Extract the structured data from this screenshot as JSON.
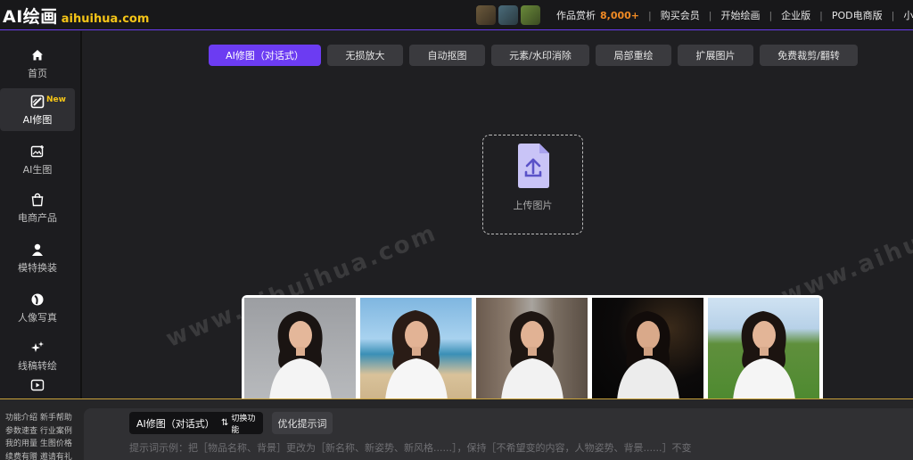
{
  "header": {
    "logo_main": "AI绘画",
    "logo_domain": "aihuihua.com",
    "nav": {
      "works_label": "作品赏析",
      "works_count": "8,000+",
      "buy_member": "购买会员",
      "start_drawing": "开始绘画",
      "enterprise": "企业版",
      "pod": "POD电商版",
      "mini_program": "小程序"
    },
    "separator": "|"
  },
  "sidebar": {
    "items": [
      {
        "label": "首页",
        "icon": "home-icon"
      },
      {
        "label": "AI修图",
        "icon": "edit-image-icon",
        "badge": "New"
      },
      {
        "label": "AI生图",
        "icon": "image-plus-icon"
      },
      {
        "label": "电商产品",
        "icon": "shopping-bag-icon"
      },
      {
        "label": "模特换装",
        "icon": "person-icon"
      },
      {
        "label": "人像写真",
        "icon": "portrait-icon"
      },
      {
        "label": "线稿转绘",
        "icon": "sparkle-icon"
      },
      {
        "label": "",
        "icon": "video-icon"
      }
    ]
  },
  "tabs": [
    {
      "label": "AI修图（对话式）",
      "active": true
    },
    {
      "label": "无损放大",
      "active": false
    },
    {
      "label": "自动抠图",
      "active": false
    },
    {
      "label": "元素/水印消除",
      "active": false
    },
    {
      "label": "局部重绘",
      "active": false
    },
    {
      "label": "扩展图片",
      "active": false
    },
    {
      "label": "免费裁剪/翻转",
      "active": false
    }
  ],
  "upload": {
    "label": "上传图片",
    "icon": "upload-file-icon"
  },
  "watermark": "www.aihuihua.com",
  "samples": [
    {
      "background": "studio"
    },
    {
      "background": "beach"
    },
    {
      "background": "street"
    },
    {
      "background": "night"
    },
    {
      "background": "field"
    }
  ],
  "help_links": [
    "功能介绍 新手帮助",
    "参数速查 行业案例",
    "我的用量 生图价格",
    "续费有赠 邀请有礼"
  ],
  "prompt": {
    "mode_label": "AI修图（对话式）",
    "switch_label": "切换功能",
    "optimize_label": "优化提示词",
    "hint": "提示词示例：把［物品名称、背景］更改为［新名称、新姿势、新风格......］，保持［不希望变的内容，人物姿势、背景......］不变"
  },
  "colors": {
    "accent": "#6c3cf2",
    "logo_domain": "#f5c518",
    "count": "#f08a24"
  }
}
